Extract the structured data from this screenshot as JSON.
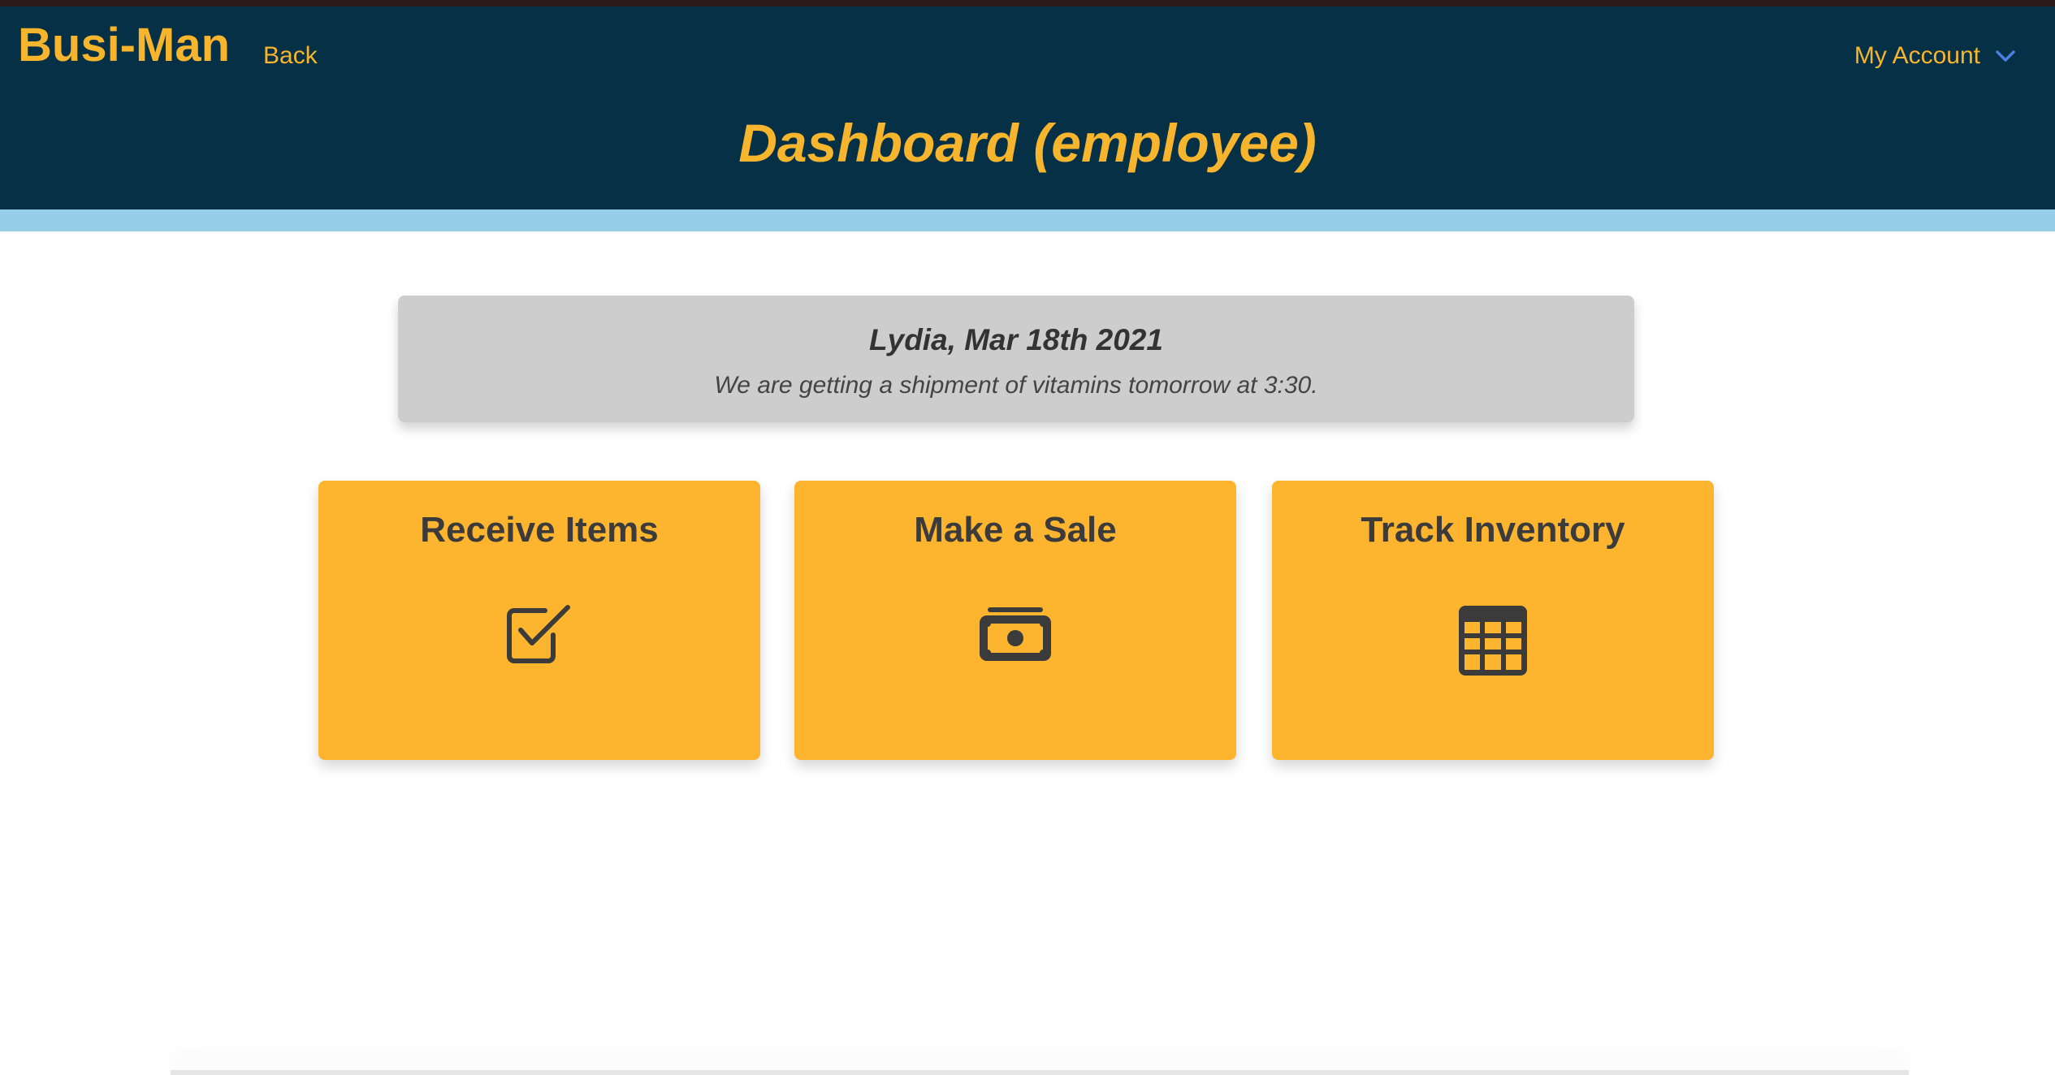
{
  "header": {
    "brand": "Busi-Man",
    "back_label": "Back",
    "account_label": "My Account",
    "page_title": "Dashboard (employee)"
  },
  "notice": {
    "title": "Lydia, Mar 18th 2021",
    "message": "We are getting a shipment of vitamins tomorrow at 3:30."
  },
  "cards": [
    {
      "title": "Receive Items",
      "icon": "checkbox-icon"
    },
    {
      "title": "Make a Sale",
      "icon": "money-bill-icon"
    },
    {
      "title": "Track Inventory",
      "icon": "table-grid-icon"
    }
  ],
  "colors": {
    "header_bg": "#053045",
    "brand": "#f7b52d",
    "accent_bar": "#96cde8",
    "card_bg": "#fdb52f",
    "notice_bg": "#cdcdcd",
    "icon": "#3b3b3b",
    "chevron": "#4a7fe0"
  }
}
